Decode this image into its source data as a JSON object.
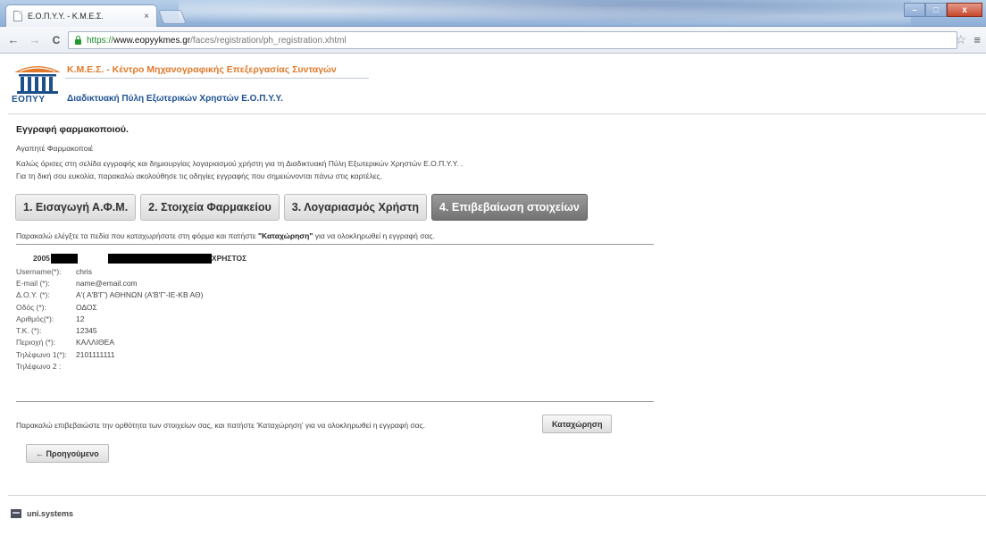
{
  "browser": {
    "tab_title": "Ε.Ο.Π.Υ.Υ. - Κ.Μ.Ε.Σ.",
    "tab_close": "×",
    "url_scheme": "https://",
    "url_host": "www.eopyykmes.gr",
    "url_path": "/faces/registration/ph_registration.xhtml",
    "back_glyph": "←",
    "forward_glyph": "→",
    "reload_glyph": "C",
    "star_glyph": "☆",
    "menu_glyph": "≡",
    "window_buttons": {
      "minimize": "–",
      "maximize": "□",
      "close": "x"
    },
    "icons": [
      "back-arrow-icon",
      "forward-arrow-icon",
      "reload-icon",
      "lock-icon",
      "star-icon",
      "menu-icon"
    ]
  },
  "header": {
    "logo_text": "ΕΟΠΥΥ",
    "title": "Κ.Μ.Ε.Σ. - Κέντρο Μηχανογραφικής Επεξεργασίας Συνταγών",
    "subtitle": "Διαδικτυακή Πύλη Εξωτερικών Χρηστών Ε.Ο.Π.Υ.Υ.",
    "colors": {
      "title": "#e0792a",
      "subtitle": "#1f5293"
    }
  },
  "main": {
    "heading": "Εγγραφή φαρμακοποιού.",
    "intro": [
      "Αγαπητέ Φαρμακοποιέ",
      "Καλώς όρισες στη σελίδα εγγραφής και δημιουργίας λογαριασμού χρήστη για τη Διαδικτυακή Πύλη Εξωτερικών Χρηστών Ε.Ο.Π.Υ.Υ. .",
      "Για τη δική σου ευκολία, παρακαλώ ακολούθησε τις οδηγίες εγγραφής που σημειώνονται πάνω στις καρτέλες."
    ],
    "steps": [
      {
        "label": "1. Εισαγωγή Α.Φ.Μ.",
        "active": false
      },
      {
        "label": "2. Στοιχεία Φαρμακείου",
        "active": false
      },
      {
        "label": "3. Λογαριασμός Χρήστη",
        "active": false
      },
      {
        "label": "4. Επιβεβαίωση στοιχείων",
        "active": true
      }
    ],
    "instruction_before": "Παρακαλώ ελέγξτε τα πεδία που καταχωρήσατε στη φόρμα και πατήστε ",
    "instruction_bold": "\"Καταχώρηση\"",
    "instruction_after": " για να ολοκληρωθεί η εγγραφή σας.",
    "person": {
      "id_prefix": "2005",
      "name_suffix": "ΧΡΗΣΤΟΣ"
    },
    "fields": [
      {
        "label": "Username(*):",
        "value": "chris"
      },
      {
        "label": "E-mail (*):",
        "value": "name@email.com"
      },
      {
        "label": "Δ.Ο.Υ. (*):",
        "value": "Α'( Α'Β'Γ') ΑΘΗΝΩΝ (Α'Β'Γ'-ΙΕ-ΚΒ ΑΘ)"
      },
      {
        "label": "Οδός (*):",
        "value": "ΟΔΟΣ"
      },
      {
        "label": "Αριθμός(*):",
        "value": "12"
      },
      {
        "label": "Τ.Κ. (*):",
        "value": "12345"
      },
      {
        "label": "Περιοχή (*):",
        "value": "ΚΑΛΛΙΘΕΑ"
      },
      {
        "label": "Τηλέφωνο 1(*):",
        "value": "2101111111"
      },
      {
        "label": "Τηλέφωνο 2 :",
        "value": ""
      }
    ],
    "confirm_text": "Παρακαλώ επιβεβαιώστε την ορθότητα των στοιχείων σας, και πατήστε 'Καταχώρηση' για να ολοκληρωθεί η εγγραφή σας.",
    "submit_label": "Καταχώρηση",
    "back_label": "← Προηγούμενο"
  },
  "footer": {
    "text": "uni.systems"
  }
}
